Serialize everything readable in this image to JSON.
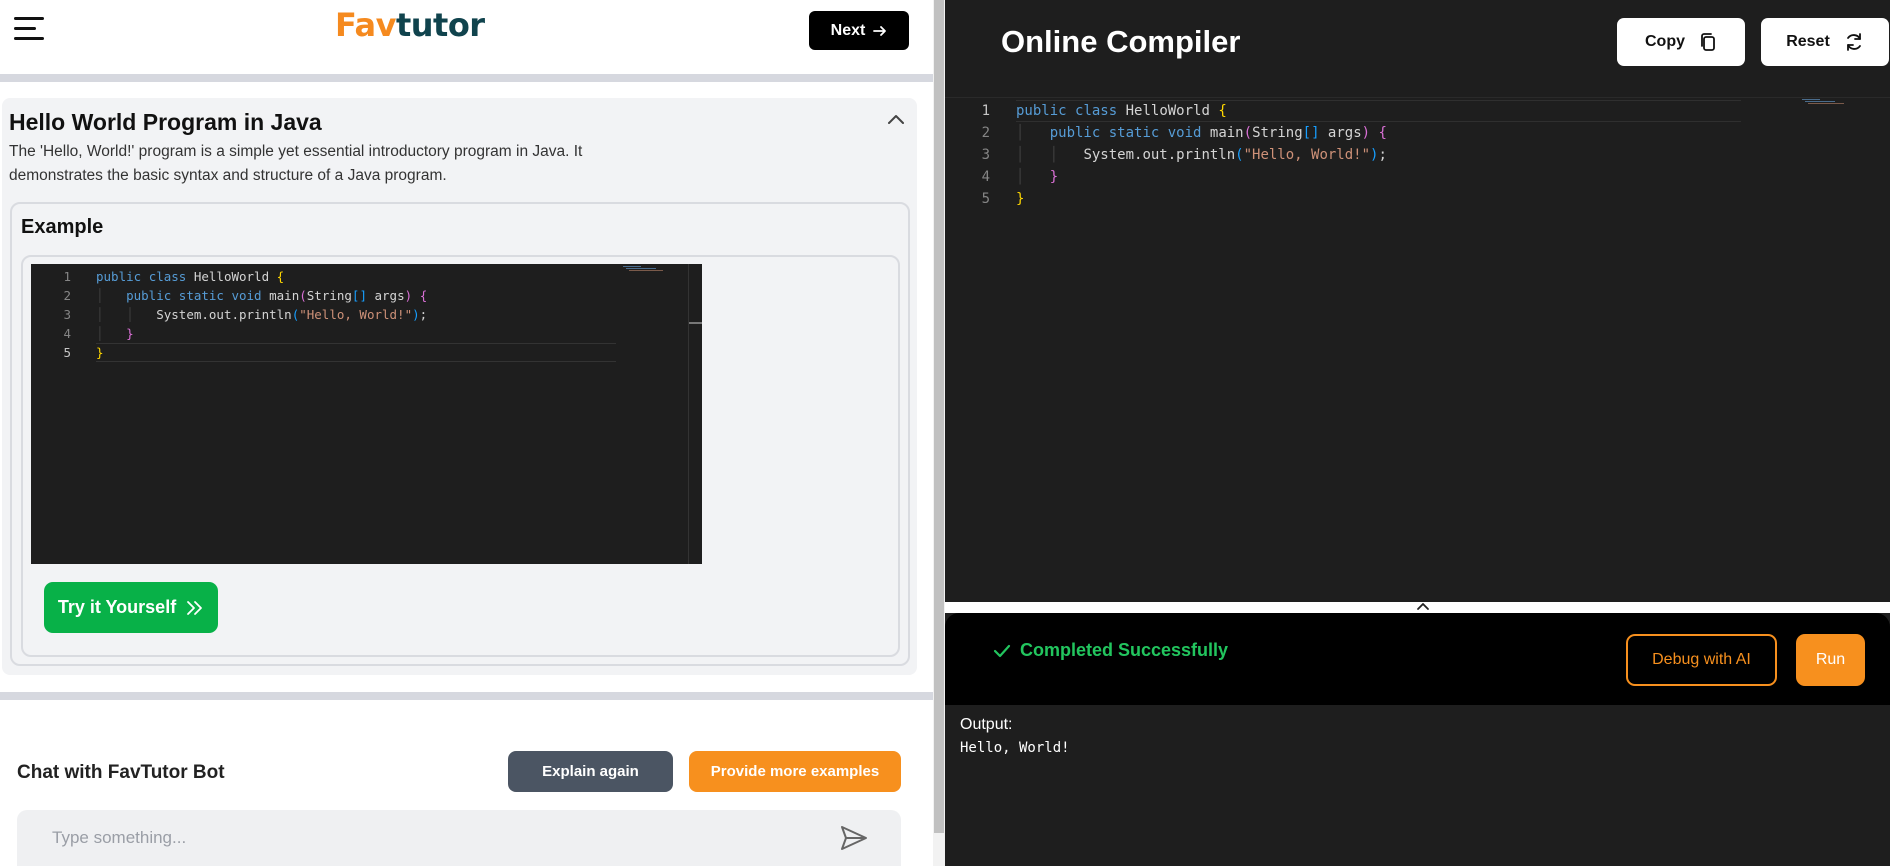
{
  "left": {
    "logo": {
      "part1": "Fa",
      "part2": "v",
      "part3": "tutor"
    },
    "next_label": "Next",
    "card": {
      "title": "Hello World Program in Java",
      "description": "The 'Hello, World!' program is a simple yet essential introductory program in Java. It demonstrates the basic syntax and structure of a Java program.",
      "example_label": "Example",
      "try_label": "Try it Yourself"
    },
    "chat": {
      "title": "Chat with FavTutor Bot",
      "explain_label": "Explain again",
      "more_label": "Provide more examples",
      "input_placeholder": "Type something..."
    }
  },
  "code": {
    "line_numbers": [
      "1",
      "2",
      "3",
      "4",
      "5"
    ],
    "lines": [
      [
        [
          "kw",
          "public"
        ],
        [
          "id",
          " "
        ],
        [
          "kw",
          "class"
        ],
        [
          "id",
          " HelloWorld "
        ],
        [
          "br1",
          "{"
        ]
      ],
      [
        [
          "guide",
          "    "
        ],
        [
          "kw",
          "public"
        ],
        [
          "id",
          " "
        ],
        [
          "kw",
          "static"
        ],
        [
          "id",
          " "
        ],
        [
          "kw",
          "void"
        ],
        [
          "id",
          " main"
        ],
        [
          "br2",
          "("
        ],
        [
          "id",
          "String"
        ],
        [
          "br3",
          "[]"
        ],
        [
          "id",
          " args"
        ],
        [
          "br2",
          ")"
        ],
        [
          "id",
          " "
        ],
        [
          "br2",
          "{"
        ]
      ],
      [
        [
          "guide",
          "    "
        ],
        [
          "guide",
          "    "
        ],
        [
          "id",
          "System.out.println"
        ],
        [
          "br3",
          "("
        ],
        [
          "str",
          "\"Hello, World!\""
        ],
        [
          "br3",
          ")"
        ],
        [
          "id",
          ";"
        ]
      ],
      [
        [
          "guide",
          "    "
        ],
        [
          "br2",
          "}"
        ]
      ],
      [
        [
          "br1",
          "}"
        ]
      ]
    ]
  },
  "right": {
    "title": "Online Compiler",
    "copy_label": "Copy",
    "reset_label": "Reset",
    "status_text": "Completed Successfully",
    "debug_label": "Debug with AI",
    "run_label": "Run",
    "output_label": "Output:",
    "output_text": "Hello, World!"
  },
  "colors": {
    "brand_orange": "#f7901e",
    "brand_teal": "#10434d",
    "success_green": "#22c55e",
    "try_green": "#08b148"
  }
}
